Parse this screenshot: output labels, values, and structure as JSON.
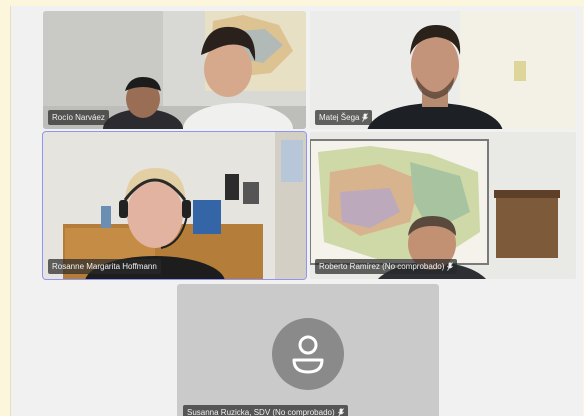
{
  "meeting": {
    "participants": [
      {
        "name": "Rocío Narváez",
        "muted": false
      },
      {
        "name": "Matej Šega",
        "muted": true
      },
      {
        "name": "Rosanne Margarita Hoffmann",
        "muted": false
      },
      {
        "name": "Roberto Ramírez (No comprobado)",
        "muted": true
      },
      {
        "name": "Susanna Ruzicka, SDV (No comprobado)",
        "muted": true,
        "camera_off": true
      }
    ],
    "active_speaker_index": 2
  },
  "colors": {
    "page_background": "#fbf6dc",
    "grid_background": "#f1f1f1",
    "active_speaker_outline": "#8f95f0",
    "name_tag_background": "#282828",
    "avatar_background": "#8a8a8a"
  },
  "icons": {
    "microphone_off": "mic-off-icon",
    "avatar": "person-avatar-icon"
  }
}
